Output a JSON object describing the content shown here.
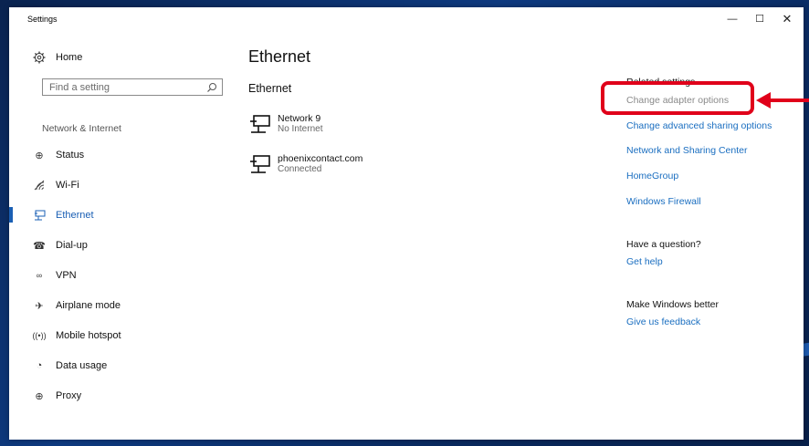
{
  "window": {
    "title": "Settings",
    "minimize_label": "—",
    "maximize_label": "☐",
    "close_label": "✕"
  },
  "nav": {
    "home_label": "Home",
    "search_placeholder": "Find a setting",
    "section_title": "Network & Internet",
    "items": [
      {
        "label": "Status",
        "icon": "globe-status-icon"
      },
      {
        "label": "Wi-Fi",
        "icon": "wifi-icon"
      },
      {
        "label": "Ethernet",
        "icon": "ethernet-icon",
        "selected": true
      },
      {
        "label": "Dial-up",
        "icon": "dialup-icon"
      },
      {
        "label": "VPN",
        "icon": "vpn-icon"
      },
      {
        "label": "Airplane mode",
        "icon": "airplane-icon"
      },
      {
        "label": "Mobile hotspot",
        "icon": "hotspot-icon"
      },
      {
        "label": "Data usage",
        "icon": "data-usage-icon"
      },
      {
        "label": "Proxy",
        "icon": "globe-icon"
      }
    ]
  },
  "main": {
    "title": "Ethernet",
    "subtitle": "Ethernet",
    "networks": [
      {
        "name": "Network 9",
        "status": "No Internet"
      },
      {
        "name": "phoenixcontact.com",
        "status": "Connected"
      }
    ]
  },
  "related": {
    "heading": "Related settings",
    "links": [
      "Change adapter options",
      "Change advanced sharing options",
      "Network and Sharing Center",
      "HomeGroup",
      "Windows Firewall"
    ],
    "question": "Have a question?",
    "help_link": "Get help",
    "better": "Make Windows better",
    "feedback_link": "Give us feedback"
  },
  "colors": {
    "accent": "#1a6ec0",
    "annotation": "#e0001a"
  }
}
